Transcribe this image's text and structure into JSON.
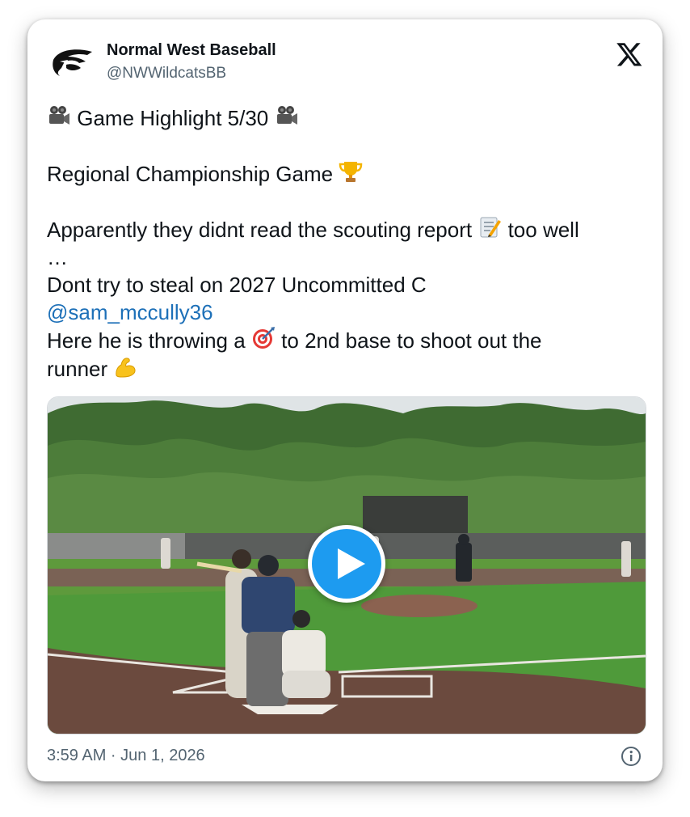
{
  "author": {
    "display_name": "Normal West Baseball",
    "handle": "@NWWildcatsBB"
  },
  "tweet": {
    "line1_pre": "Game Highlight  5/30",
    "line2": "Regional Championship Game",
    "line3a": "Apparently they didnt read the scouting report",
    "line3b": "too well",
    "line4": "…",
    "line5": "Dont try to steal on 2027 Uncommitted C",
    "mention": "@sam_mccully36",
    "line6a": "Here he is throwing a",
    "line6b": "to 2nd base to shoot out the",
    "line7": "runner"
  },
  "icons": {
    "camera": "movie-camera-icon",
    "trophy": "trophy-icon",
    "memo": "memo-icon",
    "target": "direct-hit-icon",
    "flex": "flexed-biceps-icon",
    "play": "play-icon",
    "info": "info-icon",
    "x": "x-logo-icon"
  },
  "footer": {
    "timestamp": "3:59 AM · Jun 1, 2026"
  },
  "colors": {
    "link": "#1d70b8",
    "play_button": "#1d9bf0",
    "text": "#0f1419",
    "muted": "#536471"
  }
}
